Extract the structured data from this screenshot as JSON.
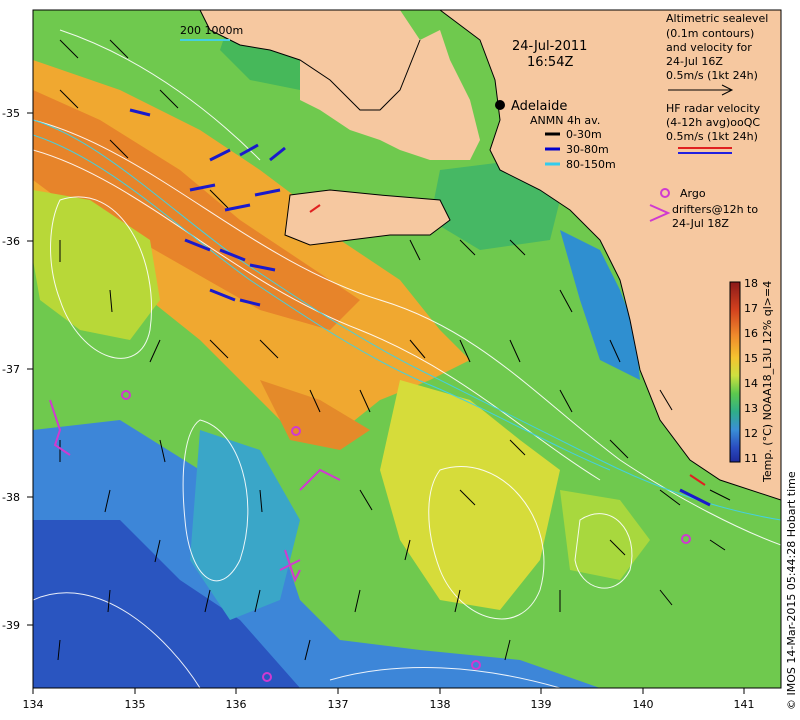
{
  "map": {
    "date": "24-Jul-2011",
    "time": "16:54Z",
    "city": "Adelaide",
    "scale_bar_label": "200  1000m"
  },
  "axes": {
    "x_ticks": [
      "134",
      "135",
      "136",
      "137",
      "138",
      "139",
      "140",
      "141"
    ],
    "y_ticks": [
      "-35",
      "-36",
      "-37",
      "-38",
      "-39"
    ]
  },
  "legend_altimetry": {
    "lines": [
      "Altimetric sealevel",
      "(0.1m contours)",
      "and velocity for",
      "24-Jul 16Z",
      "0.5m/s (1kt 24h)"
    ]
  },
  "legend_hf": {
    "lines": [
      "HF radar velocity",
      "(4-12h avg)ooQC",
      "0.5m/s (1kt 24h)"
    ]
  },
  "legend_anmn": {
    "title": "ANMN 4h av.",
    "items": [
      {
        "label": "0-30m",
        "color": "#000000"
      },
      {
        "label": "30-80m",
        "color": "#0000cc"
      },
      {
        "label": "80-150m",
        "color": "#33ccee"
      }
    ]
  },
  "legend_argo": {
    "lines": [
      "Argo",
      "drifters@12h to",
      "24-Jul 18Z"
    ],
    "color": "#cc33cc"
  },
  "colorbar": {
    "ticks": [
      "18",
      "17",
      "16",
      "15",
      "14",
      "13",
      "12",
      "11"
    ],
    "title": "Temp. (°C) NOAA18_L3U 12% ql>=4",
    "colors": [
      "#8b1a1a",
      "#c0392b",
      "#e05a1e",
      "#f08c2c",
      "#f4c430",
      "#d8e040",
      "#8ed44a",
      "#3ec25a",
      "#2fae88",
      "#33a0c8",
      "#3878d0",
      "#2a4cc0",
      "#1e2a9a"
    ]
  },
  "credit": "© IMOS 14-Mar-2015 05:44:28 Hobart time",
  "colors": {
    "land": "#f6c8a0",
    "ocean_warm": "#f2a22a",
    "ocean_mid": "#9cd43c",
    "ocean_cool": "#3fbf5a",
    "ocean_cold": "#2f7fd6"
  }
}
